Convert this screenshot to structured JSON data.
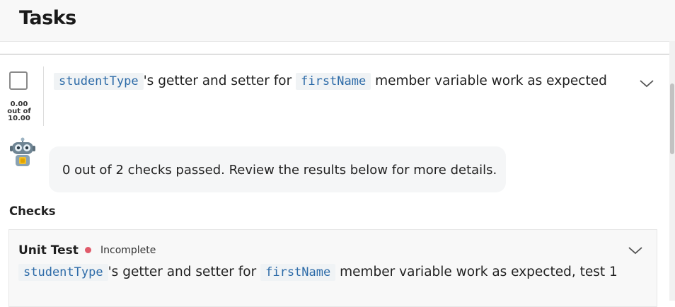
{
  "header": {
    "title": "Tasks"
  },
  "task": {
    "title_parts": [
      {
        "code": "studentType"
      },
      {
        "text": "'s getter and setter for"
      },
      {
        "code": "firstName"
      },
      {
        "text": "member variable work as expected"
      }
    ],
    "score": {
      "earned": "0.00",
      "out_of_label": "out of",
      "total": "10.00"
    },
    "expand_icon": "chevron-down-icon"
  },
  "assistant": {
    "avatar_icon": "robot-icon",
    "message": "0 out of 2 checks passed. Review the results below for more details."
  },
  "checks": {
    "heading": "Checks",
    "items": [
      {
        "type": "Unit Test",
        "status": "Incomplete",
        "status_color": "#e05a6a",
        "description_parts": [
          {
            "code": "studentType"
          },
          {
            "text": "'s getter and setter for"
          },
          {
            "code": "firstName"
          },
          {
            "text": "member variable work as expected, test 1"
          }
        ]
      }
    ]
  },
  "colors": {
    "code_text": "#2d6ba8",
    "code_bg": "#f0f3f5",
    "header_bg": "#f8f8f8"
  }
}
